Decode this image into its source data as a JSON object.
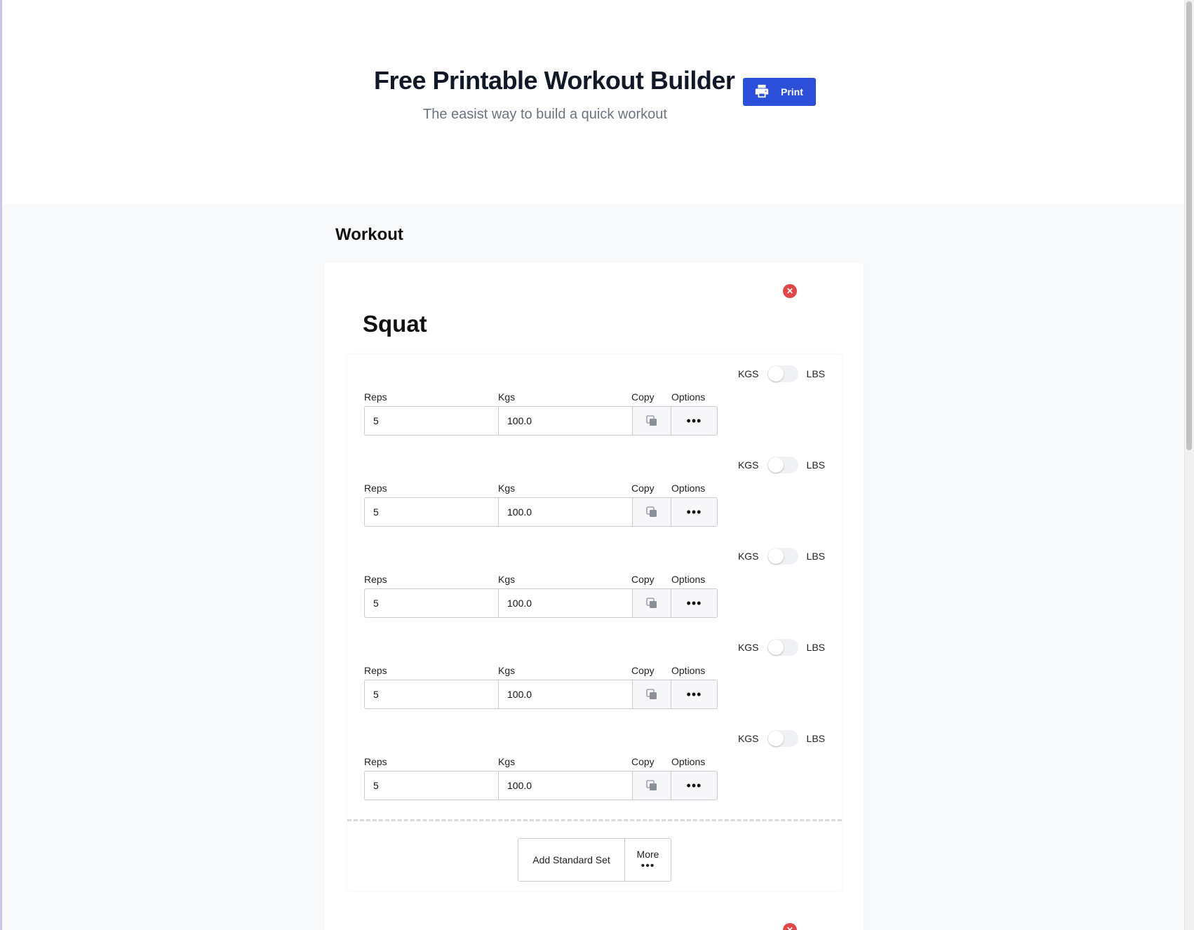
{
  "header": {
    "title": "Free Printable Workout Builder",
    "subtitle": "The easist way to build a quick workout",
    "print_label": "Print"
  },
  "workout": {
    "section_title": "Workout",
    "exercise": {
      "name": "Squat",
      "labels": {
        "reps": "Reps",
        "kgs": "Kgs",
        "copy": "Copy",
        "options": "Options"
      },
      "unit_toggle": {
        "left": "KGS",
        "right": "LBS"
      },
      "sets": [
        {
          "reps": "5",
          "weight": "100.0"
        },
        {
          "reps": "5",
          "weight": "100.0"
        },
        {
          "reps": "5",
          "weight": "100.0"
        },
        {
          "reps": "5",
          "weight": "100.0"
        },
        {
          "reps": "5",
          "weight": "100.0"
        }
      ],
      "add_standard_set_label": "Add Standard Set",
      "more_label": "More"
    }
  },
  "colors": {
    "accent": "#2b4fd8",
    "danger": "#e04848"
  }
}
